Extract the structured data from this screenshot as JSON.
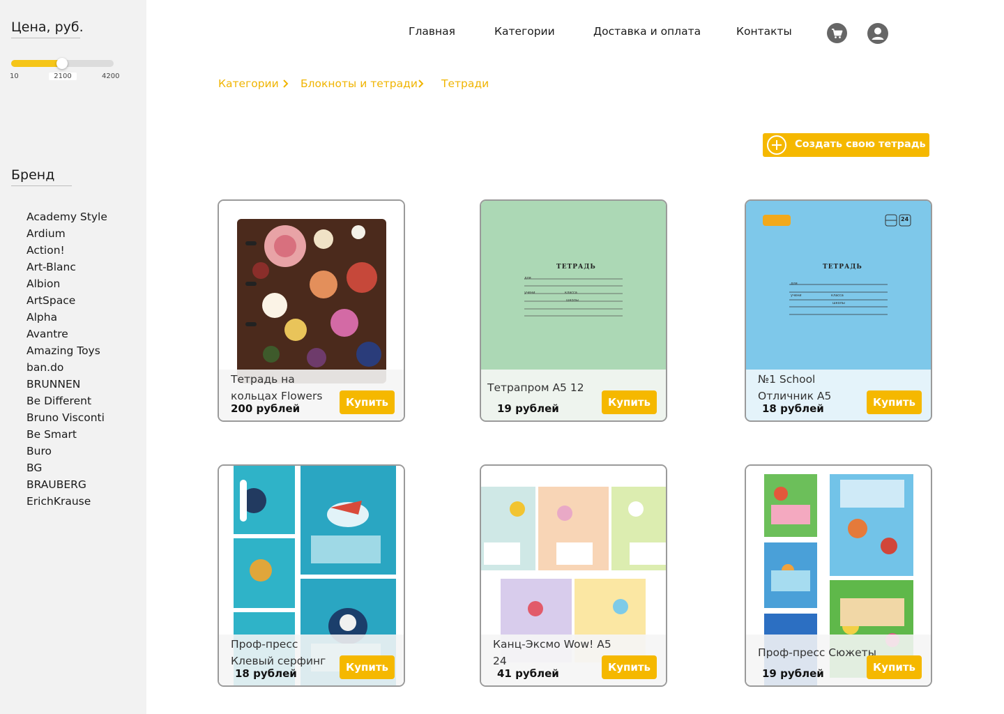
{
  "sidebar": {
    "price_title": "Цена, руб.",
    "price_slider": {
      "min": "10",
      "current": "2100",
      "max": "4200",
      "value": 2100,
      "range": [
        10,
        4200
      ]
    },
    "brand_title": "Бренд",
    "brands": [
      "Academy Style",
      "Ardium",
      "Action!",
      "Art-Blanc",
      "Albion",
      "ArtSpace",
      "Alpha",
      "Avantre",
      "Amazing Toys",
      "ban.do",
      "BRUNNEN",
      "Be Different",
      "Bruno Visconti",
      "Be Smart",
      "Buro",
      "BG",
      "BRAUBERG",
      "ErichKrause"
    ]
  },
  "nav": {
    "home": "Главная",
    "categories": "Категории",
    "delivery": "Доставка и оплата",
    "contacts": "Контакты"
  },
  "icons": {
    "cart": "cart-icon",
    "account": "user-account-icon",
    "create": "plus-circle-icon",
    "chevron": "chevron-right-icon"
  },
  "breadcrumb": [
    "Категории",
    "Блокноты и тетради",
    "Тетради"
  ],
  "create_button": "Создать свою тетрадь",
  "buy_label": "Купить",
  "products": [
    {
      "name": "Тетрадь на кольцах Flowers",
      "price": "200 рублей",
      "image": "floral-ring-binder"
    },
    {
      "name": "Тетрапром А5 12",
      "price": "19 рублей",
      "image": "green-notebook-cover"
    },
    {
      "name": "№1 School Отличник А5",
      "price": "18 рублей",
      "image": "blue-notebook-cover"
    },
    {
      "name": "Проф-пресс Клевый серфинг",
      "price": "18 рублей",
      "image": "surf-notebooks-set"
    },
    {
      "name": "Канц-Эксмо Wow! А5 24",
      "price": "41 рублей",
      "image": "pastel-notebooks-set"
    },
    {
      "name": "Проф-пресс Сюжеты",
      "price": "19 рублей",
      "image": "story-notebooks-set"
    }
  ],
  "cover_text": {
    "title": "ТЕТРАДЬ",
    "field_for": "для",
    "field_student": "учени",
    "field_class": "класса",
    "field_school": "школы",
    "sheets": "24"
  },
  "colors": {
    "accent": "#f5b800",
    "sidebar_bg": "#f2f2f2",
    "link": "#f0b400"
  }
}
